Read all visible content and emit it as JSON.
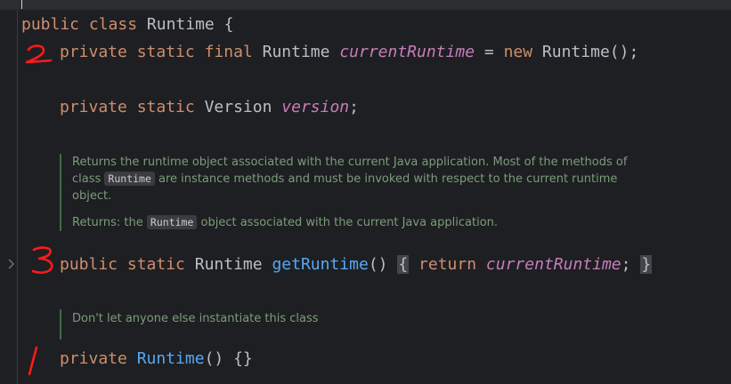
{
  "editor": {
    "line_class": {
      "kw1": "public",
      "kw2": "class",
      "name": "Runtime",
      "brace": "{"
    },
    "line_current": {
      "kw1": "private",
      "kw2": "static",
      "kw3": "final",
      "type": "Runtime",
      "field": "currentRuntime",
      "eq": "=",
      "kw4": "new",
      "ctor": "Runtime();"
    },
    "line_version": {
      "kw1": "private",
      "kw2": "static",
      "type": "Version",
      "field": "version",
      "semi": ";"
    },
    "doc_getruntime": {
      "text1": "Returns the runtime object associated with the current Java application. Most of the methods of",
      "text2a": "class",
      "chip1": "Runtime",
      "text2b": "are instance methods and must be invoked with respect to the current runtime",
      "text3": "object.",
      "returns_label": "Returns: the",
      "chip2": "Runtime",
      "returns_rest": "object associated with the current Java application."
    },
    "line_getruntime": {
      "kw1": "public",
      "kw2": "static",
      "type": "Runtime",
      "method": "getRuntime",
      "parens": "()",
      "open": "{",
      "kw3": "return",
      "field": "currentRuntime",
      "semi": ";",
      "close": "}"
    },
    "doc_ctor": {
      "text": "Don't let anyone else instantiate this class"
    },
    "line_ctor": {
      "kw1": "private",
      "method": "Runtime",
      "rest": "() {}"
    }
  },
  "annotations": {
    "colors": {
      "ink": "#ff1a1a"
    },
    "numbers": [
      "2",
      "3",
      "1"
    ]
  }
}
